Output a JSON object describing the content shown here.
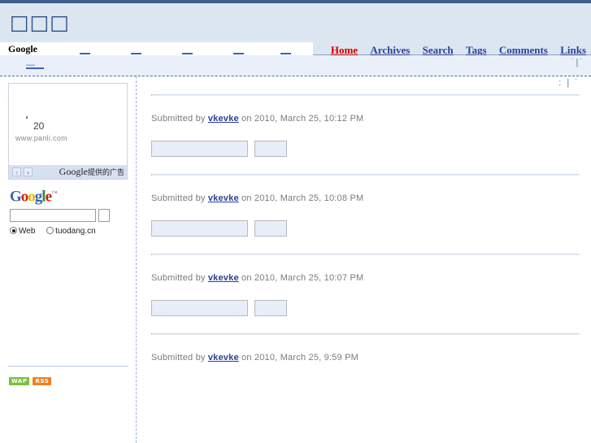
{
  "header": {
    "site_title": "□□□",
    "google_bar": {
      "label": "Google",
      "links": [
        "–",
        "–",
        "–",
        "–",
        "–"
      ]
    },
    "nav": [
      {
        "label": "Home",
        "active": true
      },
      {
        "label": "Archives",
        "active": false
      },
      {
        "label": "Search",
        "active": false
      },
      {
        "label": "Tags",
        "active": false
      },
      {
        "label": "Comments",
        "active": false
      },
      {
        "label": "Links",
        "active": false
      }
    ]
  },
  "subbar": {
    "breadcrumb_left": "—",
    "breadcrumb_right": "˙|˙"
  },
  "sidebar": {
    "ad": {
      "number": "20",
      "url": "www.panli.com",
      "prev_arrow": "‹",
      "next_arrow": "›",
      "attrib_google": "Google",
      "attrib_text": "提供的广告"
    },
    "google_search": {
      "logo_letters": [
        {
          "ch": "G",
          "color": "b"
        },
        {
          "ch": "o",
          "color": "r"
        },
        {
          "ch": "o",
          "color": "y"
        },
        {
          "ch": "g",
          "color": "b"
        },
        {
          "ch": "l",
          "color": "g"
        },
        {
          "ch": "e",
          "color": "r"
        }
      ],
      "trademark": "™",
      "input_value": "",
      "input_placeholder": "",
      "button_label": "",
      "radios": [
        {
          "label": "Web",
          "checked": true
        },
        {
          "label": "tuodang.cn",
          "checked": false
        }
      ]
    },
    "badges": [
      {
        "label": "WAP",
        "color": "#79c040"
      },
      {
        "label": "RSS",
        "color": "#f08020"
      }
    ]
  },
  "content": {
    "header_marks": ": | ˙",
    "posts": [
      {
        "title": "",
        "meta_prefix": "Submitted by ",
        "author": "vkevke",
        "meta_suffix": " on 2010, March 25, 10:12 PM"
      },
      {
        "title": "",
        "meta_prefix": "Submitted by ",
        "author": "vkevke",
        "meta_suffix": " on 2010, March 25, 10:08 PM"
      },
      {
        "title": "",
        "meta_prefix": "Submitted by ",
        "author": "vkevke",
        "meta_suffix": " on 2010, March 25, 10:07 PM"
      },
      {
        "title": "",
        "meta_prefix": "Submitted by ",
        "author": "vkevke",
        "meta_suffix": " on 2010, March 25, 9:59 PM"
      }
    ]
  }
}
